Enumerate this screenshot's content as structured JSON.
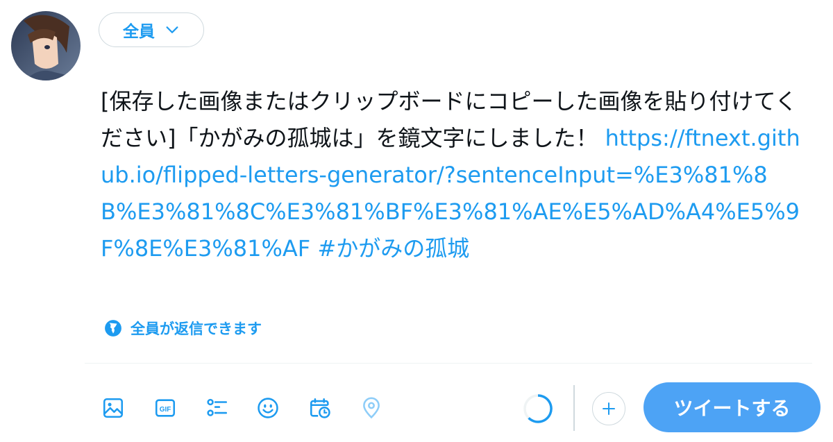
{
  "composer": {
    "audience_label": "全員",
    "text_body": "[保存した画像またはクリップボードにコピーした画像を貼り付けてください]「かがみの孤城は」を鏡文字にしました！ ",
    "link_text": "https://ftnext.github.io/flipped-letters-generator/?sentenceInput=%E3%81%8B%E3%81%8C%E3%81%BF%E3%81%AE%E5%AD%A4%E5%9F%8E%E3%81%AF",
    "hashtag": " #かがみの孤城",
    "reply_setting_label": "全員が返信できます"
  },
  "toolbar": {
    "icons": [
      "image-icon",
      "gif-icon",
      "poll-icon",
      "emoji-icon",
      "schedule-icon",
      "location-icon"
    ],
    "tweet_button_label": "ツイートする",
    "gif_label": "GIF"
  },
  "colors": {
    "accent": "#1d9bf0",
    "button": "#4da3f5",
    "border": "#cfd9de",
    "text": "#0f1419"
  }
}
